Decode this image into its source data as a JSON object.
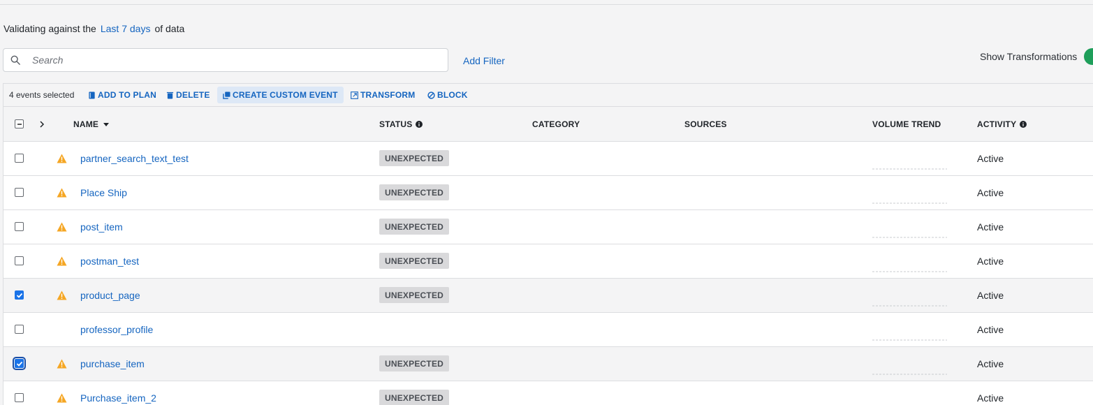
{
  "validation": {
    "prefix": "Validating against the",
    "range_link": "Last 7 days",
    "suffix": "of data"
  },
  "search": {
    "placeholder": "Search",
    "value": ""
  },
  "add_filter": "Add Filter",
  "show_transformations": {
    "label": "Show Transformations",
    "enabled": true
  },
  "actions": {
    "selected_count": "4 events selected",
    "add_to_plan": "ADD TO PLAN",
    "delete": "DELETE",
    "create_custom_event": "CREATE CUSTOM EVENT",
    "transform": "TRANSFORM",
    "block": "BLOCK"
  },
  "columns": {
    "name": "NAME",
    "status": "STATUS",
    "category": "CATEGORY",
    "sources": "SOURCES",
    "volume_trend": "VOLUME TREND",
    "activity": "ACTIVITY"
  },
  "rows": [
    {
      "name": "partner_search_text_test",
      "status": "UNEXPECTED",
      "warning": true,
      "checked": false,
      "activity": "Active"
    },
    {
      "name": "Place Ship",
      "status": "UNEXPECTED",
      "warning": true,
      "checked": false,
      "activity": "Active"
    },
    {
      "name": "post_item",
      "status": "UNEXPECTED",
      "warning": true,
      "checked": false,
      "activity": "Active"
    },
    {
      "name": "postman_test",
      "status": "UNEXPECTED",
      "warning": true,
      "checked": false,
      "activity": "Active"
    },
    {
      "name": "product_page",
      "status": "UNEXPECTED",
      "warning": true,
      "checked": true,
      "activity": "Active"
    },
    {
      "name": "professor_profile",
      "status": "",
      "warning": false,
      "checked": false,
      "activity": "Active"
    },
    {
      "name": "purchase_item",
      "status": "UNEXPECTED",
      "warning": true,
      "checked": true,
      "activity": "Active"
    },
    {
      "name": "Purchase_item_2",
      "status": "UNEXPECTED",
      "warning": true,
      "checked": false,
      "activity": "Active"
    }
  ],
  "colors": {
    "link": "#1565c0",
    "warning": "#f5a623",
    "checkbox_checked": "#1a73e8",
    "toggle_on": "#1e9e5a",
    "badge_bg": "#d9d9db"
  }
}
